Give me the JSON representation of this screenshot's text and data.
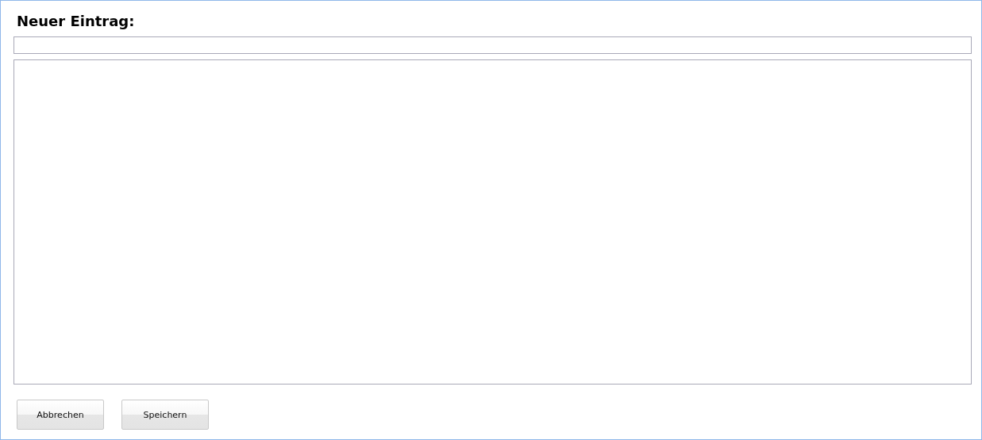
{
  "heading": "Neuer Eintrag:",
  "fields": [
    {
      "kind": "line"
    },
    {
      "kind": "area"
    }
  ],
  "buttons": [
    {
      "label": "Abbrechen"
    },
    {
      "label": "Speichern"
    }
  ]
}
